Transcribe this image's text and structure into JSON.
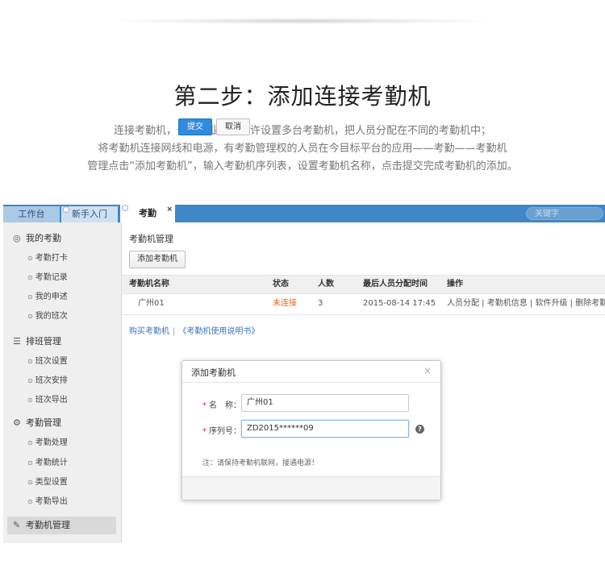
{
  "page": {
    "title": "第二步：添加连接考勤机",
    "intro": [
      "连接考勤机，一个企业号中允许设置多台考勤机，把人员分配在不同的考勤机中；",
      "将考勤机连接网线和电源，有考勤管理权的人员在今目标平台的应用——考勤——考勤机",
      "管理点击“添加考勤机”，输入考勤机序列表，设置考勤机名称，点击提交完成考勤机的添加。"
    ]
  },
  "tabs": {
    "workbench": "工作台",
    "newbie": "新手入门",
    "attendance": "考勤",
    "close": "×"
  },
  "search": {
    "placeholder": "关键字"
  },
  "sidebar": {
    "my_attendance": {
      "label": "我的考勤",
      "items": [
        "考勤打卡",
        "考勤记录",
        "我的申述",
        "我的班次"
      ]
    },
    "shift_mgmt": {
      "label": "排班管理",
      "items": [
        "班次设置",
        "班次安排",
        "班次导出"
      ]
    },
    "attendance_mgmt": {
      "label": "考勤管理",
      "items": [
        "考勤处理",
        "考勤统计",
        "类型设置",
        "考勤导出"
      ]
    },
    "machine_mgmt": {
      "label": "考勤机管理"
    }
  },
  "main": {
    "title": "考勤机管理",
    "add_button": "添加考勤机",
    "columns": [
      "考勤机名称",
      "状态",
      "人数",
      "最后人员分配时间",
      "操作"
    ],
    "rows": [
      {
        "name": "广州01",
        "status": "未连接",
        "count": "3",
        "last_assign": "2015-08-14 17:45",
        "actions": "人员分配 | 考勤机信息 | 软件升级 | 删除考勤机"
      }
    ],
    "links": {
      "buy": "购买考勤机",
      "separator": "|",
      "manual": "《考勤机使用说明书》"
    }
  },
  "dialog": {
    "title": "添加考勤机",
    "close": "×",
    "name_label": "名　称：",
    "name_value": "广州01",
    "serial_label": "序列号：",
    "serial_value": "ZD2015******09",
    "required_mark": "*",
    "help": "?",
    "note": "注：请保持考勤机联网，接通电源！",
    "submit": "提交",
    "cancel": "取消"
  },
  "colors": {
    "tabbar": "#3f87c9",
    "submit_blue": "#2f8be0",
    "status_orange": "#e3661c",
    "link_blue": "#3a73b6"
  }
}
